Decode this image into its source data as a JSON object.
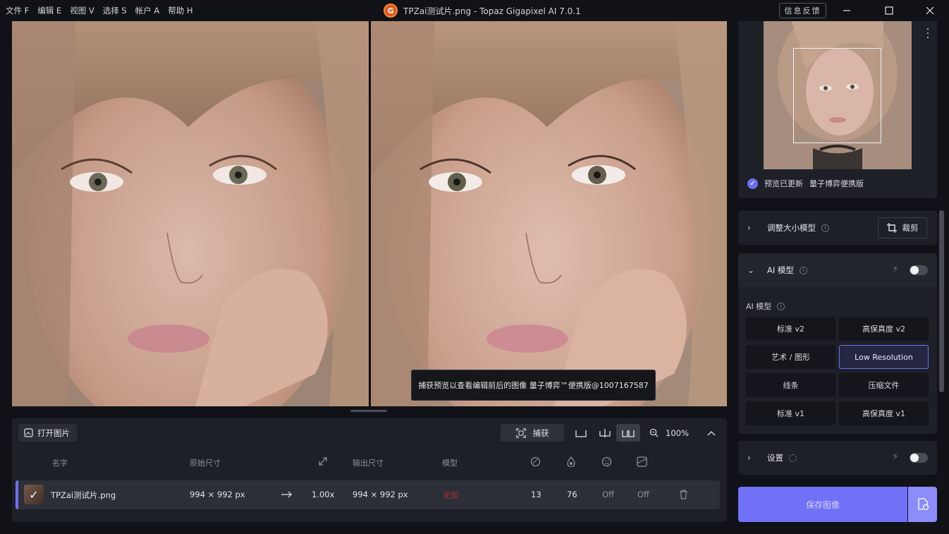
{
  "menu": [
    "文件 F",
    "编辑 E",
    "视图 V",
    "选择 S",
    "帐户 A",
    "帮助 H"
  ],
  "window": {
    "logo_letter": "G",
    "title": "TPZai测试片.png - Topaz Gigapixel AI 7.0.1",
    "feedback": "信息反馈"
  },
  "viewer": {
    "tooltip": "捕获预览以查看编辑前后的图像 量子博弈™便携版@1007167587"
  },
  "toolbar": {
    "open_label": "打开图片",
    "capture_label": "捕获",
    "zoom_value": "100%"
  },
  "table": {
    "headers": {
      "name": "名字",
      "original_size": "原始尺寸",
      "output_size": "输出尺寸",
      "model": "模型"
    },
    "row": {
      "name": "TPZai测试片.png",
      "original_size": "994 × 992 px",
      "scale": "1.00x",
      "output_size": "994 × 992 px",
      "model": "无知",
      "model_color": "#b0302c",
      "v1": "13",
      "v2": "76",
      "v3": "Off",
      "v4": "Off"
    }
  },
  "navigator": {
    "status": "预览已更新",
    "watermark": "量子博弈便携版"
  },
  "resize_card": {
    "title": "调整大小模型",
    "crop_label": "裁剪"
  },
  "ai_card": {
    "title": "AI 模型",
    "sub_label": "AI 模型",
    "models": [
      "标准 v2",
      "高保真度 v2",
      "艺术 / 图形",
      "Low Resolution",
      "线条",
      "压缩文件",
      "标准 v1",
      "高保真度 v1"
    ],
    "selected": "Low Resolution"
  },
  "settings_card": {
    "title": "设置"
  },
  "save": {
    "label": "保存图像"
  },
  "colors": {
    "accent": "#6d6ff0",
    "save_button": "#7071f6"
  }
}
